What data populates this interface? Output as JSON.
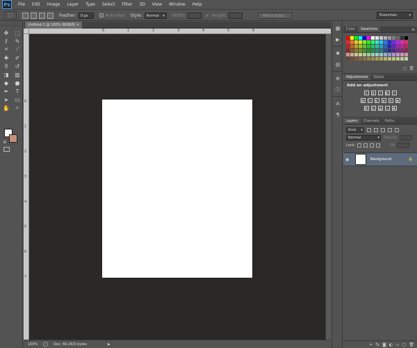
{
  "app": {
    "logo": "Ps"
  },
  "menu": [
    "File",
    "Edit",
    "Image",
    "Layer",
    "Type",
    "Select",
    "Filter",
    "3D",
    "View",
    "Window",
    "Help"
  ],
  "options": {
    "feather_label": "Feather:",
    "feather_value": "0 px",
    "antialias_label": "Anti-alias",
    "style_label": "Style:",
    "style_value": "Normal",
    "width_label": "Width:",
    "height_label": "Height:",
    "refine_label": "Refine Edge...",
    "workspace": "Essentials"
  },
  "document": {
    "tab": "Untitled-1 @ 100% (RGB/8)",
    "ruler_h": [
      "0",
      "1",
      "2",
      "3",
      "4",
      "5",
      "6"
    ],
    "ruler_v": [
      "0",
      "1",
      "2",
      "3",
      "4",
      "5",
      "6",
      "7"
    ],
    "zoom": "100%",
    "doc_info": "Doc: 60.2K/0 bytes",
    "canvas_color": "#ffffff",
    "pasteboard_color": "#2b2928"
  },
  "tools": [
    "move-tool-icon",
    "marquee-tool-icon",
    "lasso-tool-icon",
    "quick-select-tool-icon",
    "crop-tool-icon",
    "eyedropper-tool-icon",
    "healing-brush-tool-icon",
    "brush-tool-icon",
    "clone-stamp-tool-icon",
    "history-brush-tool-icon",
    "eraser-tool-icon",
    "gradient-tool-icon",
    "blur-tool-icon",
    "dodge-tool-icon",
    "pen-tool-icon",
    "type-tool-icon",
    "path-select-tool-icon",
    "shape-tool-icon",
    "hand-tool-icon",
    "zoom-tool-icon"
  ],
  "colors": {
    "foreground": "#ffffff",
    "background": "#c8907a"
  },
  "swatches_panel": {
    "tabs": [
      "Color",
      "Swatches"
    ],
    "active_tab": "Swatches"
  },
  "adjustments_panel": {
    "tabs": [
      "Adjustments",
      "Styles"
    ],
    "title": "Add an adjustment"
  },
  "layers_panel": {
    "tabs": [
      "Layers",
      "Channels",
      "Paths"
    ],
    "kind_label": "Kind",
    "blend_mode": "Normal",
    "opacity_label": "Opacity:",
    "fill_label": "Fill:",
    "lock_label": "Lock:",
    "layer_name": "Background",
    "layer_row_color": "#5d6b7d"
  }
}
